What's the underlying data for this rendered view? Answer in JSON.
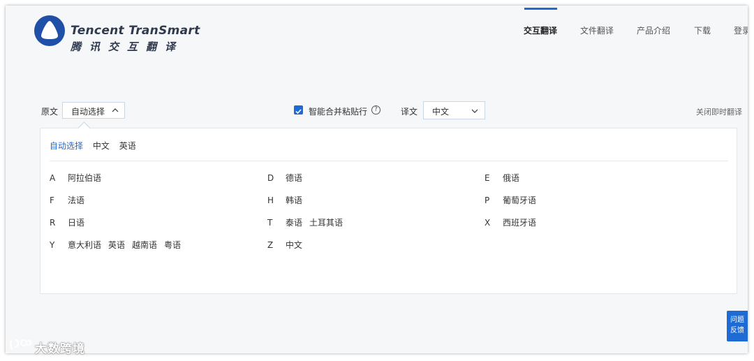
{
  "brand": {
    "name_en": "Tencent TranSmart",
    "name_cn": "腾讯交互翻译",
    "logo_color": "#1f4fa6"
  },
  "nav": {
    "items": [
      "交互翻译",
      "文件翻译",
      "产品介绍",
      "下载",
      "登录"
    ],
    "active_index": 0,
    "accent": "#1e6bd6"
  },
  "toolbar": {
    "source_label": "原文",
    "source_value": "自动选择",
    "merge_paste_label": "智能合并粘贴行",
    "merge_paste_checked": true,
    "help_icon": "?",
    "target_label": "译文",
    "target_value": "中文",
    "close_instant": "关闭即时翻译"
  },
  "dropdown": {
    "quick": [
      "自动选择",
      "中文",
      "英语"
    ],
    "quick_active_index": 0,
    "groups": [
      {
        "letter": "A",
        "langs": [
          "阿拉伯语"
        ]
      },
      {
        "letter": "D",
        "langs": [
          "德语"
        ]
      },
      {
        "letter": "E",
        "langs": [
          "俄语"
        ]
      },
      {
        "letter": "F",
        "langs": [
          "法语"
        ]
      },
      {
        "letter": "H",
        "langs": [
          "韩语"
        ]
      },
      {
        "letter": "P",
        "langs": [
          "葡萄牙语"
        ]
      },
      {
        "letter": "R",
        "langs": [
          "日语"
        ]
      },
      {
        "letter": "T",
        "langs": [
          "泰语",
          "土耳其语"
        ]
      },
      {
        "letter": "X",
        "langs": [
          "西班牙语"
        ]
      },
      {
        "letter": "Y",
        "langs": [
          "意大利语",
          "英语",
          "越南语",
          "粤语"
        ]
      },
      {
        "letter": "Z",
        "langs": [
          "中文"
        ]
      }
    ]
  },
  "feedback": {
    "line1": "问题",
    "line2": "反馈"
  },
  "watermark": "大数跨境"
}
